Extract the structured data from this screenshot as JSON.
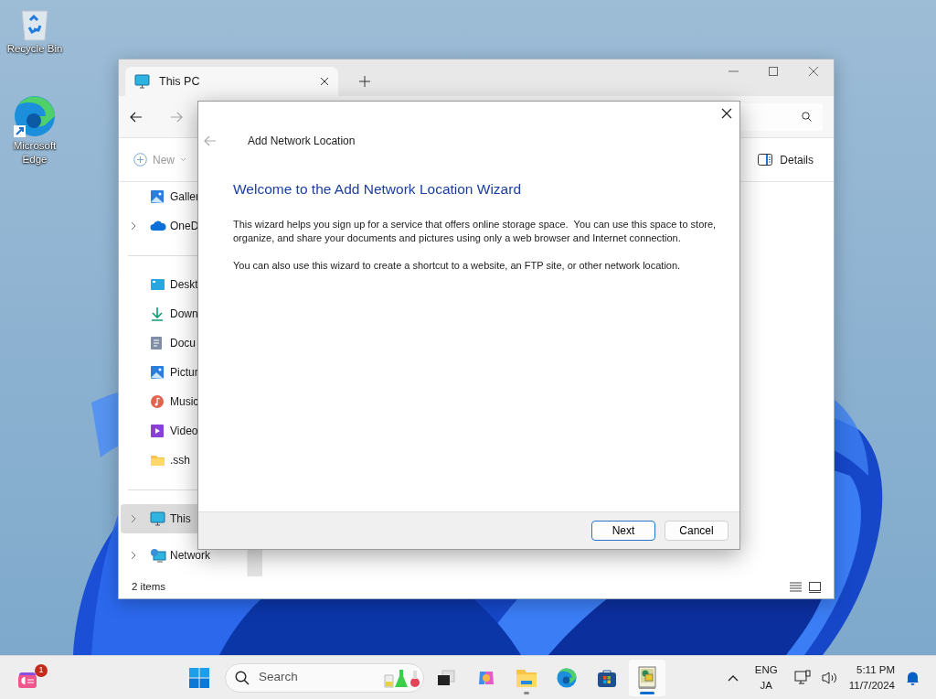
{
  "desktop_icons": [
    {
      "kind": "recycle",
      "label": "Recycle Bin"
    },
    {
      "kind": "edge",
      "label": "Microsoft Edge"
    }
  ],
  "explorer": {
    "tab": {
      "title": "This PC"
    },
    "command_bar": {
      "new": "New",
      "details": "Details"
    },
    "sidebar": {
      "groups": [
        [
          {
            "kind": "gallery",
            "label": "Galler",
            "expandable": false,
            "selected": false
          },
          {
            "kind": "cloud",
            "label": "OneD",
            "expandable": true,
            "selected": false
          }
        ],
        [
          {
            "kind": "desktop",
            "label": "Deskt",
            "expandable": false,
            "selected": false
          },
          {
            "kind": "download",
            "label": "Down",
            "expandable": false,
            "selected": false
          },
          {
            "kind": "document",
            "label": "Docu",
            "expandable": false,
            "selected": false
          },
          {
            "kind": "pictures",
            "label": "Pictur",
            "expandable": false,
            "selected": false
          },
          {
            "kind": "music",
            "label": "Music",
            "expandable": false,
            "selected": false
          },
          {
            "kind": "video",
            "label": "Video",
            "expandable": false,
            "selected": false
          },
          {
            "kind": "folder",
            "label": ".ssh",
            "expandable": false,
            "selected": false
          }
        ],
        [
          {
            "kind": "pc",
            "label": "This",
            "expandable": true,
            "selected": true
          },
          {
            "kind": "network",
            "label": "Network",
            "expandable": true,
            "selected": false
          }
        ]
      ]
    },
    "status_bar": "2 items"
  },
  "dialog": {
    "title": "Add Network Location",
    "heading": "Welcome to the Add Network Location Wizard",
    "paragraphs": [
      "This wizard helps you sign up for a service that offers online storage space.  You can use this space to store, organize, and share your documents and pictures using only a web browser and Internet connection.",
      "You can also use this wizard to create a shortcut to a website, an FTP site, or other network location."
    ],
    "buttons": [
      {
        "label": "Next",
        "default": true
      },
      {
        "label": "Cancel",
        "default": false
      }
    ]
  },
  "taskbar": {
    "widget_badge": "1",
    "search": {
      "placeholder": "Search"
    },
    "apps": [
      {
        "kind": "taskview",
        "running": false,
        "active": false
      },
      {
        "kind": "copilot",
        "running": false,
        "active": false
      },
      {
        "kind": "explorer",
        "running": true,
        "active": false
      },
      {
        "kind": "edge",
        "running": false,
        "active": false
      },
      {
        "kind": "store",
        "running": false,
        "active": false
      },
      {
        "kind": "wizard",
        "running": true,
        "active": true
      }
    ],
    "language": [
      "ENG",
      "JA"
    ],
    "time": "5:11 PM",
    "date": "11/7/2024"
  }
}
